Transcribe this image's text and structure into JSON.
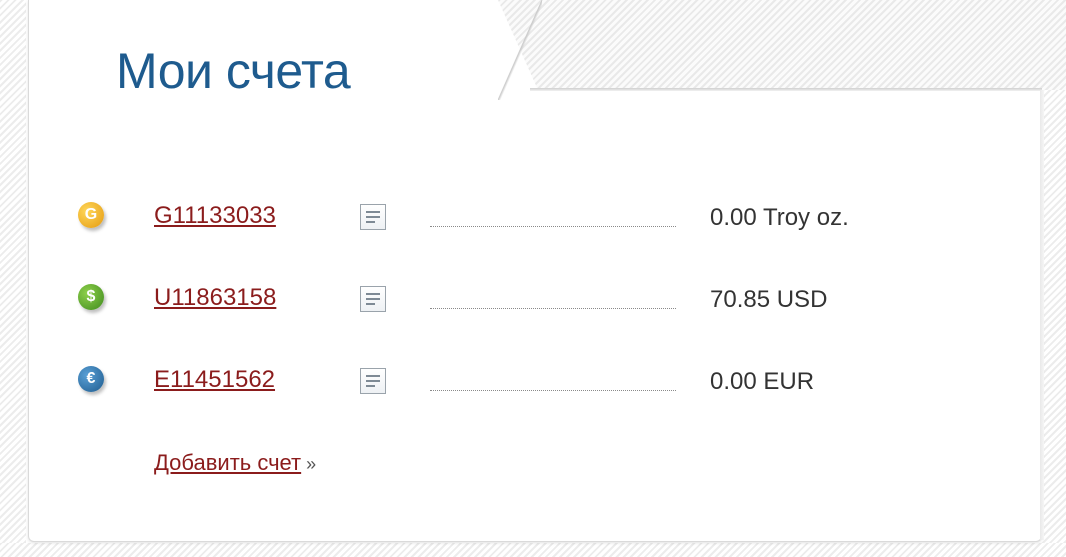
{
  "title": "Мои счета",
  "accounts": [
    {
      "currency_icon": "gold-coin-icon",
      "icon_glyph": "G",
      "id": "G11133033",
      "balance": "0.00 Troy oz.",
      "color": "#e49a10"
    },
    {
      "currency_icon": "dollar-coin-icon",
      "icon_glyph": "$",
      "id": "U11863158",
      "balance": "70.85 USD",
      "color": "#3f8a1e"
    },
    {
      "currency_icon": "euro-coin-icon",
      "icon_glyph": "€",
      "id": "E11451562",
      "balance": "0.00 EUR",
      "color": "#1e5b8e"
    }
  ],
  "add_account": {
    "label": "Добавить счет",
    "arrow": "»"
  },
  "colors": {
    "title": "#1e5b8e",
    "link": "#8b1c1c",
    "text": "#333333"
  }
}
